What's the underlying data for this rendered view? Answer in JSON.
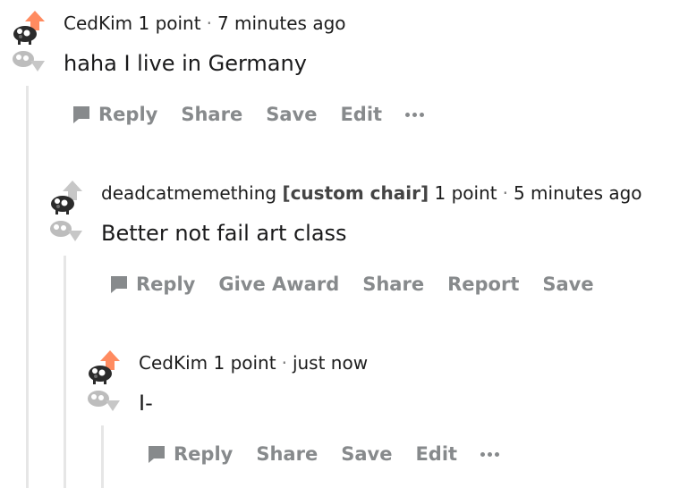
{
  "comments": [
    {
      "username": "CedKim",
      "flair": "",
      "points": "1 point",
      "time": "7 minutes ago",
      "text": "haha I live in Germany",
      "upvoted": true,
      "actions": [
        "Reply",
        "Share",
        "Save",
        "Edit"
      ],
      "has_more": true
    },
    {
      "username": "deadcatmemething",
      "flair": "[custom chair]",
      "points": "1 point",
      "time": "5 minutes ago",
      "text": "Better not fail art class",
      "upvoted": false,
      "actions": [
        "Reply",
        "Give Award",
        "Share",
        "Report",
        "Save"
      ],
      "has_more": false
    },
    {
      "username": "CedKim",
      "flair": "",
      "points": "1 point",
      "time": "just now",
      "text": "I-",
      "upvoted": true,
      "actions": [
        "Reply",
        "Share",
        "Save",
        "Edit"
      ],
      "has_more": true
    }
  ],
  "colors": {
    "upvote_active": "#ff8b60",
    "vote_inactive": "#c7c7c7",
    "action_text": "#878a8c",
    "thread_line": "#e6e6e6"
  },
  "icons": [
    "upvote-arrow-icon",
    "downvote-arrow-icon",
    "reply-bubble-icon",
    "more-dots-icon"
  ]
}
